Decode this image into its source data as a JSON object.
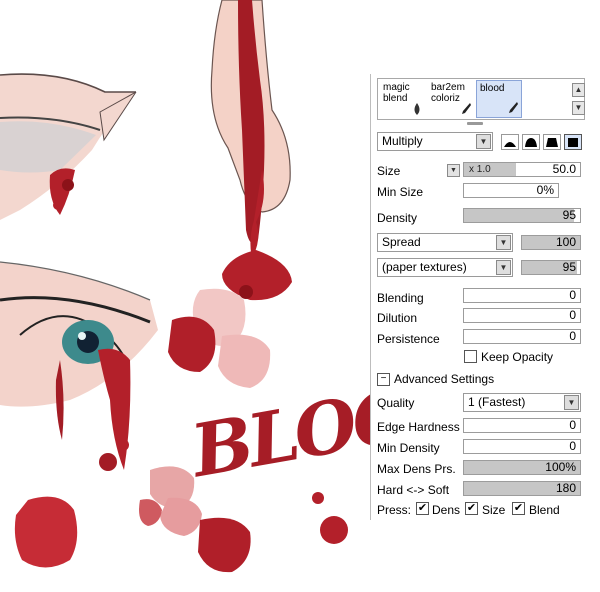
{
  "colors": {
    "blood": "#b3202a",
    "blood_dark": "#8c1219",
    "skin": "#f2cfc6",
    "panel_bg": "#ffffff"
  },
  "tools": [
    {
      "line1": "magic",
      "line2": "blend",
      "icon": "droplet-icon"
    },
    {
      "line1": "bar2em",
      "line2": "coloriz",
      "icon": "brush-icon"
    },
    {
      "line1": "blood",
      "line2": "",
      "icon": "brush-icon",
      "selected": true
    }
  ],
  "blend_mode": "Multiply",
  "size": {
    "label": "Size",
    "multiplier": "x 1.0",
    "value": "50.0"
  },
  "min_size": {
    "label": "Min Size",
    "value": "0%"
  },
  "density": {
    "label": "Density",
    "value": "95",
    "fill": 0.95
  },
  "texture1": {
    "select": "Spread",
    "value": "100",
    "fill": 1.0
  },
  "texture2": {
    "select": "(paper textures)",
    "value": "95",
    "fill": 0.95
  },
  "blending": {
    "label": "Blending",
    "value": "0"
  },
  "dilution": {
    "label": "Dilution",
    "value": "0"
  },
  "persistence": {
    "label": "Persistence",
    "value": "0"
  },
  "keep_opacity": {
    "label": "Keep Opacity",
    "checked": false
  },
  "advanced": {
    "label": "Advanced Settings"
  },
  "quality": {
    "label": "Quality",
    "value": "1 (Fastest)"
  },
  "edge_hardness": {
    "label": "Edge Hardness",
    "value": "0"
  },
  "min_density": {
    "label": "Min Density",
    "value": "0"
  },
  "max_dens_prs": {
    "label": "Max Dens Prs.",
    "value": "100%",
    "fill": 1.0
  },
  "hard_soft": {
    "label": "Hard <-> Soft",
    "value": "180",
    "fill": 1.0
  },
  "press": {
    "label": "Press:",
    "dens": "Dens",
    "size": "Size",
    "blend": "Blend"
  },
  "artwork": {
    "text": "BLOOD"
  }
}
